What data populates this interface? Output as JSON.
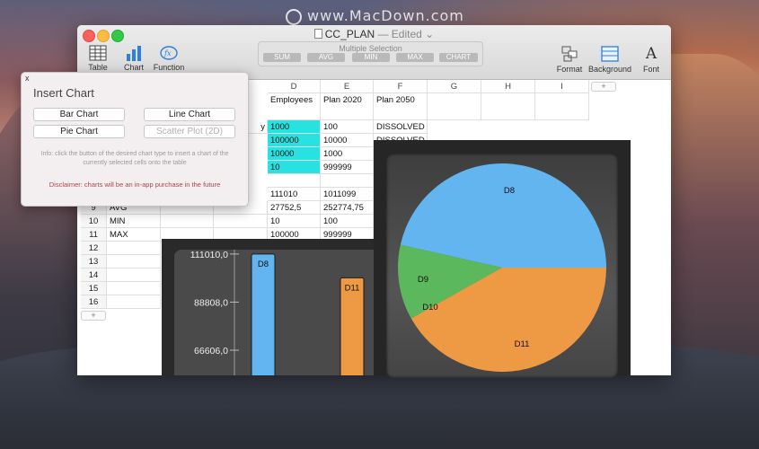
{
  "watermark": "www.MacDown.com",
  "window": {
    "title": "CC_PLAN",
    "edited": "— Edited ⌄",
    "toolbar": {
      "table": "Table",
      "chart": "Chart",
      "function": "Function",
      "format": "Format",
      "background": "Background",
      "font": "Font"
    },
    "selection": {
      "caption": "Multiple Selection",
      "buttons": [
        "SUM",
        "AVG",
        "MIN",
        "MAX",
        "CHART"
      ]
    }
  },
  "sheet": {
    "columns": [
      "D",
      "E",
      "F",
      "G",
      "H",
      "I"
    ],
    "add_column": "+",
    "add_row": "+",
    "header_row": [
      "Employees",
      "Plan 2020",
      "Plan 2050"
    ],
    "partial_c_cell": "y",
    "data_rows": [
      [
        "1000",
        "100",
        "DISSOLVED"
      ],
      [
        "100000",
        "10000",
        "DISSOLVED"
      ],
      [
        "10000",
        "1000",
        ""
      ],
      [
        "10",
        "999999",
        ""
      ]
    ],
    "stat_rows": [
      {
        "num": "",
        "label": "",
        "d": "111010",
        "e": "1011099"
      },
      {
        "num": "9",
        "label": "AVG",
        "d": "27752,5",
        "e": "252774,75"
      },
      {
        "num": "10",
        "label": "MIN",
        "d": "10",
        "e": "100"
      },
      {
        "num": "11",
        "label": "MAX",
        "d": "100000",
        "e": "999999"
      }
    ],
    "empty_rows": [
      "12",
      "13",
      "14",
      "15",
      "16"
    ]
  },
  "insert_chart": {
    "close": "x",
    "title": "Insert Chart",
    "bar": "Bar Chart",
    "line": "Line Chart",
    "pie": "Pie Chart",
    "scatter": "Scatter Plot (2D)",
    "info": "Info: click the button of the desired chart type to insert a chart of the currently selected cells onto the table",
    "disclaimer": "Disclaimer: charts will be an in-app purchase in the future"
  },
  "colors": {
    "blue": "#62b5ee",
    "orange": "#ee9a45",
    "green": "#5cb85c",
    "cyan": "#28e2e2"
  },
  "chart_data": [
    {
      "type": "bar",
      "categories": [
        "D8",
        "D11"
      ],
      "values": [
        111010,
        100000
      ],
      "ytick_labels": [
        "111010,0",
        "88808,0",
        "66606,0"
      ],
      "yticks": [
        111010,
        88808,
        66606
      ],
      "ylim": [
        55000,
        118000
      ]
    },
    {
      "type": "pie",
      "labels": [
        "D8",
        "D9",
        "D10",
        "D11"
      ],
      "values": [
        111010,
        27752.5,
        10,
        100000
      ]
    }
  ]
}
